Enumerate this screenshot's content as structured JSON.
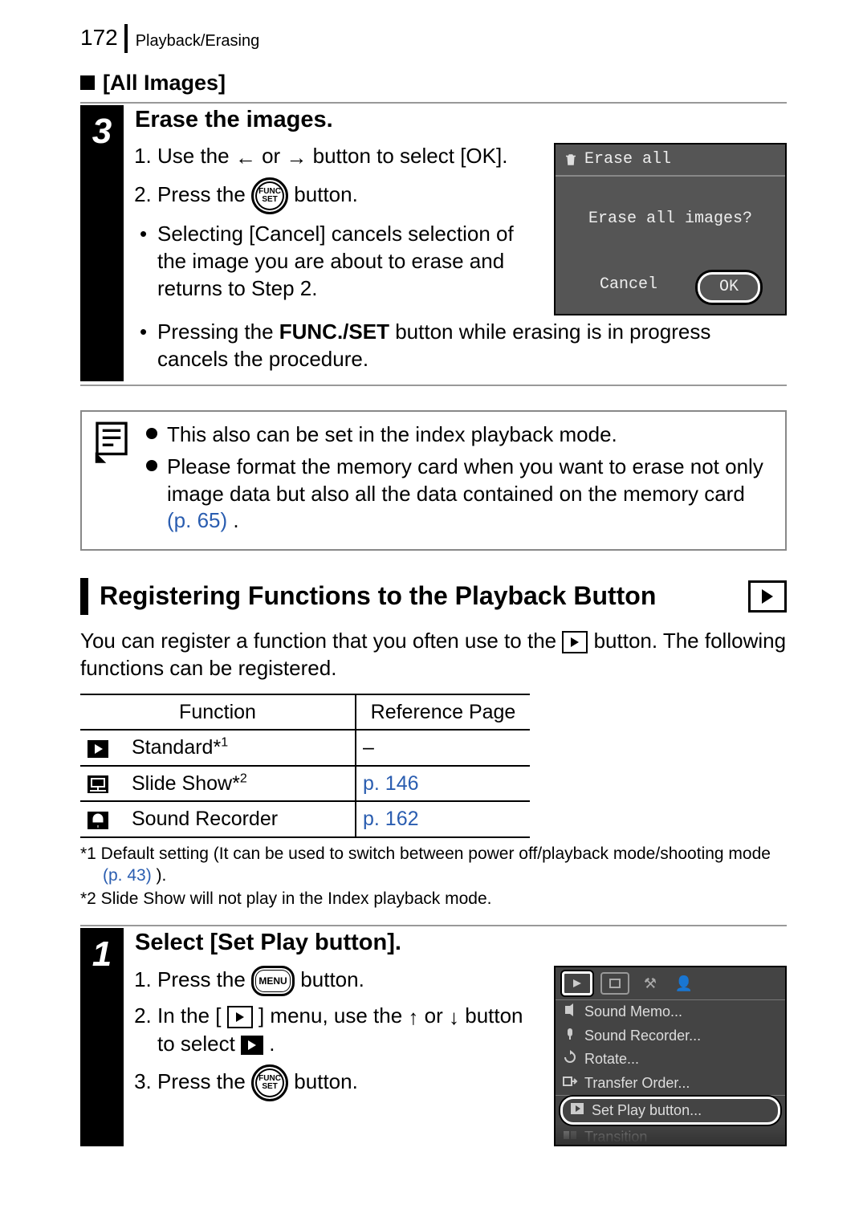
{
  "header": {
    "page_number": "172",
    "section": "Playback/Erasing"
  },
  "sub_heading": "[All Images]",
  "step3": {
    "number": "3",
    "title": "Erase the images.",
    "li1_a": "Use the ",
    "li1_b": " or ",
    "li1_c": " button to select [OK].",
    "li2_a": "Press the ",
    "li2_b": " button.",
    "bullet1": "Selecting [Cancel] cancels selection of the image you are about to erase and returns to Step 2.",
    "bullet2_a": "Pressing the ",
    "bullet2_bold": "FUNC./SET",
    "bullet2_b": " button while erasing is in progress cancels the procedure."
  },
  "lcd1": {
    "title": "Erase all",
    "message": "Erase all images?",
    "cancel": "Cancel",
    "ok": "OK"
  },
  "note": {
    "n1": "This also can be set in the index playback mode.",
    "n2_a": "Please format the memory card when you want to erase not only image data but also all the data contained on the memory card ",
    "n2_link": "(p. 65)",
    "n2_b": "."
  },
  "heading2": "Registering Functions to the Playback Button",
  "intro_a": "You can register a function that you often use to the ",
  "intro_b": " button. The following functions can be registered.",
  "table": {
    "h1": "Function",
    "h2": "Reference Page",
    "r1_name": "Standard*",
    "r1_sup": "1",
    "r1_ref": "–",
    "r2_name": "Slide Show*",
    "r2_sup": "2",
    "r2_ref": "p. 146",
    "r3_name": "Sound Recorder",
    "r3_ref": "p. 162"
  },
  "footnotes": {
    "f1_a": "*1 Default setting (It can be used to switch between power off/playback mode/shooting mode ",
    "f1_link": "(p. 43)",
    "f1_b": ").",
    "f2": "*2 Slide Show will not play in the Index playback mode."
  },
  "step1": {
    "number": "1",
    "title": "Select [Set Play button].",
    "li1_a": "Press the ",
    "li1_b": " button.",
    "li2_a": "In the [",
    "li2_b": "] menu, use the ",
    "li2_c": " or ",
    "li2_d": " button to select ",
    "li2_e": ".",
    "li3_a": "Press the ",
    "li3_b": " button."
  },
  "lcd2": {
    "m1": "Sound Memo...",
    "m2": "Sound Recorder...",
    "m3": "Rotate...",
    "m4": "Transfer Order...",
    "m5": "Set Play button...",
    "m6": "Transition"
  }
}
